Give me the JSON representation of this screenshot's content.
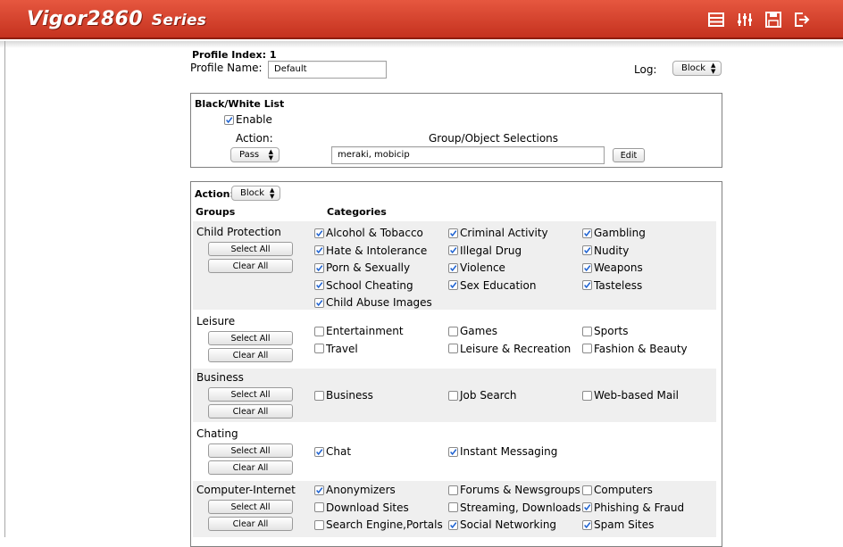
{
  "header": {
    "brand": "Vigor2860",
    "series": "Series",
    "icons": [
      "menu-list-icon",
      "equalizer-icon",
      "save-icon",
      "logout-icon"
    ]
  },
  "profile": {
    "index_label": "Profile Index: 1",
    "name_label": "Profile Name:",
    "name_value": "Default",
    "log_label": "Log:",
    "log_value": "Block"
  },
  "bwlist": {
    "title": "Black/White List",
    "enable_label": "Enable",
    "enable_checked": true,
    "action_label": "Action:",
    "action_value": "Pass",
    "selections_label": "Group/Object Selections",
    "selections_value": "meraki, mobicip",
    "edit_label": "Edit"
  },
  "categories": {
    "action_label": "Action:",
    "action_value": "Block",
    "groups_header": "Groups",
    "categories_header": "Categories",
    "select_all_label": "Select All",
    "clear_all_label": "Clear All",
    "groups": [
      {
        "name": "Child Protection",
        "items": [
          {
            "label": "Alcohol & Tobacco",
            "checked": true
          },
          {
            "label": "Criminal Activity",
            "checked": true
          },
          {
            "label": "Gambling",
            "checked": true
          },
          {
            "label": "Hate & Intolerance",
            "checked": true
          },
          {
            "label": "Illegal Drug",
            "checked": true
          },
          {
            "label": "Nudity",
            "checked": true
          },
          {
            "label": "Porn & Sexually",
            "checked": true
          },
          {
            "label": "Violence",
            "checked": true
          },
          {
            "label": "Weapons",
            "checked": true
          },
          {
            "label": "School Cheating",
            "checked": true
          },
          {
            "label": "Sex Education",
            "checked": true
          },
          {
            "label": "Tasteless",
            "checked": true
          },
          {
            "label": "Child Abuse Images",
            "checked": true
          }
        ]
      },
      {
        "name": "Leisure",
        "items": [
          {
            "label": "Entertainment",
            "checked": false
          },
          {
            "label": "Games",
            "checked": false
          },
          {
            "label": "Sports",
            "checked": false
          },
          {
            "label": "Travel",
            "checked": false
          },
          {
            "label": "Leisure & Recreation",
            "checked": false
          },
          {
            "label": "Fashion & Beauty",
            "checked": false
          }
        ]
      },
      {
        "name": "Business",
        "items": [
          {
            "label": "Business",
            "checked": false
          },
          {
            "label": "Job Search",
            "checked": false
          },
          {
            "label": "Web-based Mail",
            "checked": false
          }
        ]
      },
      {
        "name": "Chating",
        "items": [
          {
            "label": "Chat",
            "checked": true
          },
          {
            "label": "Instant Messaging",
            "checked": true
          }
        ]
      },
      {
        "name": "Computer-Internet",
        "items": [
          {
            "label": "Anonymizers",
            "checked": true
          },
          {
            "label": "Forums & Newsgroups",
            "checked": false
          },
          {
            "label": "Computers",
            "checked": false
          },
          {
            "label": "Download Sites",
            "checked": false
          },
          {
            "label": "Streaming, Downloads",
            "checked": false
          },
          {
            "label": "Phishing & Fraud",
            "checked": true
          },
          {
            "label": "Search Engine,Portals",
            "checked": false
          },
          {
            "label": "Social Networking",
            "checked": true
          },
          {
            "label": "Spam Sites",
            "checked": true
          }
        ]
      }
    ]
  },
  "colors": {
    "header_top": "#e6573f",
    "header_bottom": "#c5321f",
    "row_grey": "#efefef",
    "check": "#1a5fd0"
  }
}
